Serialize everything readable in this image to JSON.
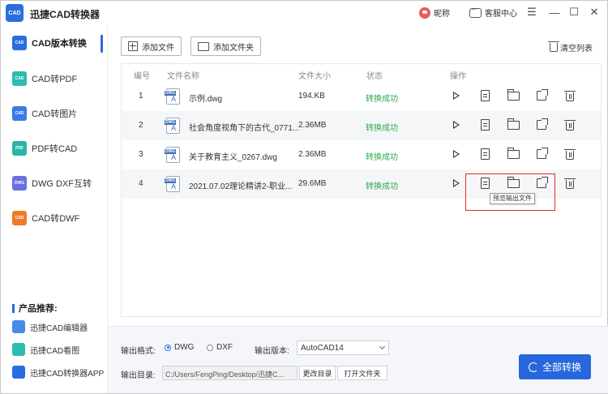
{
  "app": {
    "title": "迅捷CAD转换器",
    "logo_text": "CAD"
  },
  "titlebar": {
    "user_label": "昵称",
    "service_label": "客服中心",
    "menu_glyph": "☰",
    "min_glyph": "—",
    "max_glyph": "☐",
    "close_glyph": "✕"
  },
  "sidebar": {
    "items": [
      {
        "label": "CAD版本转换",
        "icon": "cad-version-icon",
        "color": "#2a6de0"
      },
      {
        "label": "CAD转PDF",
        "icon": "cad-to-pdf-icon",
        "color": "#2dbcb0"
      },
      {
        "label": "CAD转图片",
        "icon": "cad-to-image-icon",
        "color": "#3a7be6"
      },
      {
        "label": "PDF转CAD",
        "icon": "pdf-to-cad-icon",
        "color": "#29b6a8"
      },
      {
        "label": "DWG DXF互转",
        "icon": "dwg-dxf-icon",
        "color": "#6b6fe0"
      },
      {
        "label": "CAD转DWF",
        "icon": "cad-to-dwf-icon",
        "color": "#f07a2a"
      }
    ],
    "recommend_title": "产品推荐:",
    "recommend": [
      {
        "label": "迅捷CAD编辑器"
      },
      {
        "label": "迅捷CAD看图"
      },
      {
        "label": "迅捷CAD转换器APP"
      }
    ]
  },
  "toolbar": {
    "add_file": "添加文件",
    "add_folder": "添加文件夹",
    "clear_list": "清空列表"
  },
  "table": {
    "headers": {
      "num": "编号",
      "name": "文件名称",
      "size": "文件大小",
      "status": "状态",
      "ops": "操作"
    },
    "rows": [
      {
        "num": "1",
        "name": "示例.dwg",
        "size": "194.KB",
        "status": "转换成功"
      },
      {
        "num": "2",
        "name": "社会角度视角下的古代_0771...",
        "size": "2.36MB",
        "status": "转换成功"
      },
      {
        "num": "3",
        "name": "关于教育主义_0267.dwg",
        "size": "2.36MB",
        "status": "转换成功"
      },
      {
        "num": "4",
        "name": "2021.07.02理论精讲2-职业...",
        "size": "29.6MB",
        "status": "转换成功"
      }
    ],
    "tooltip": "预览输出文件"
  },
  "settings": {
    "format_label": "输出格式:",
    "format_options": [
      "DWG",
      "DXF"
    ],
    "format_selected": "DWG",
    "version_label": "输出版本:",
    "version_value": "AutoCAD14",
    "dir_label": "输出目录:",
    "dir_value": "C:/Users/FengPing/Desktop/迅捷C...",
    "change_dir": "更改目录",
    "open_folder": "打开文件夹"
  },
  "convert_all": "全部转换",
  "colors": {
    "accent": "#2767dd",
    "success": "#2fa84f",
    "highlight": "#e0302a"
  }
}
